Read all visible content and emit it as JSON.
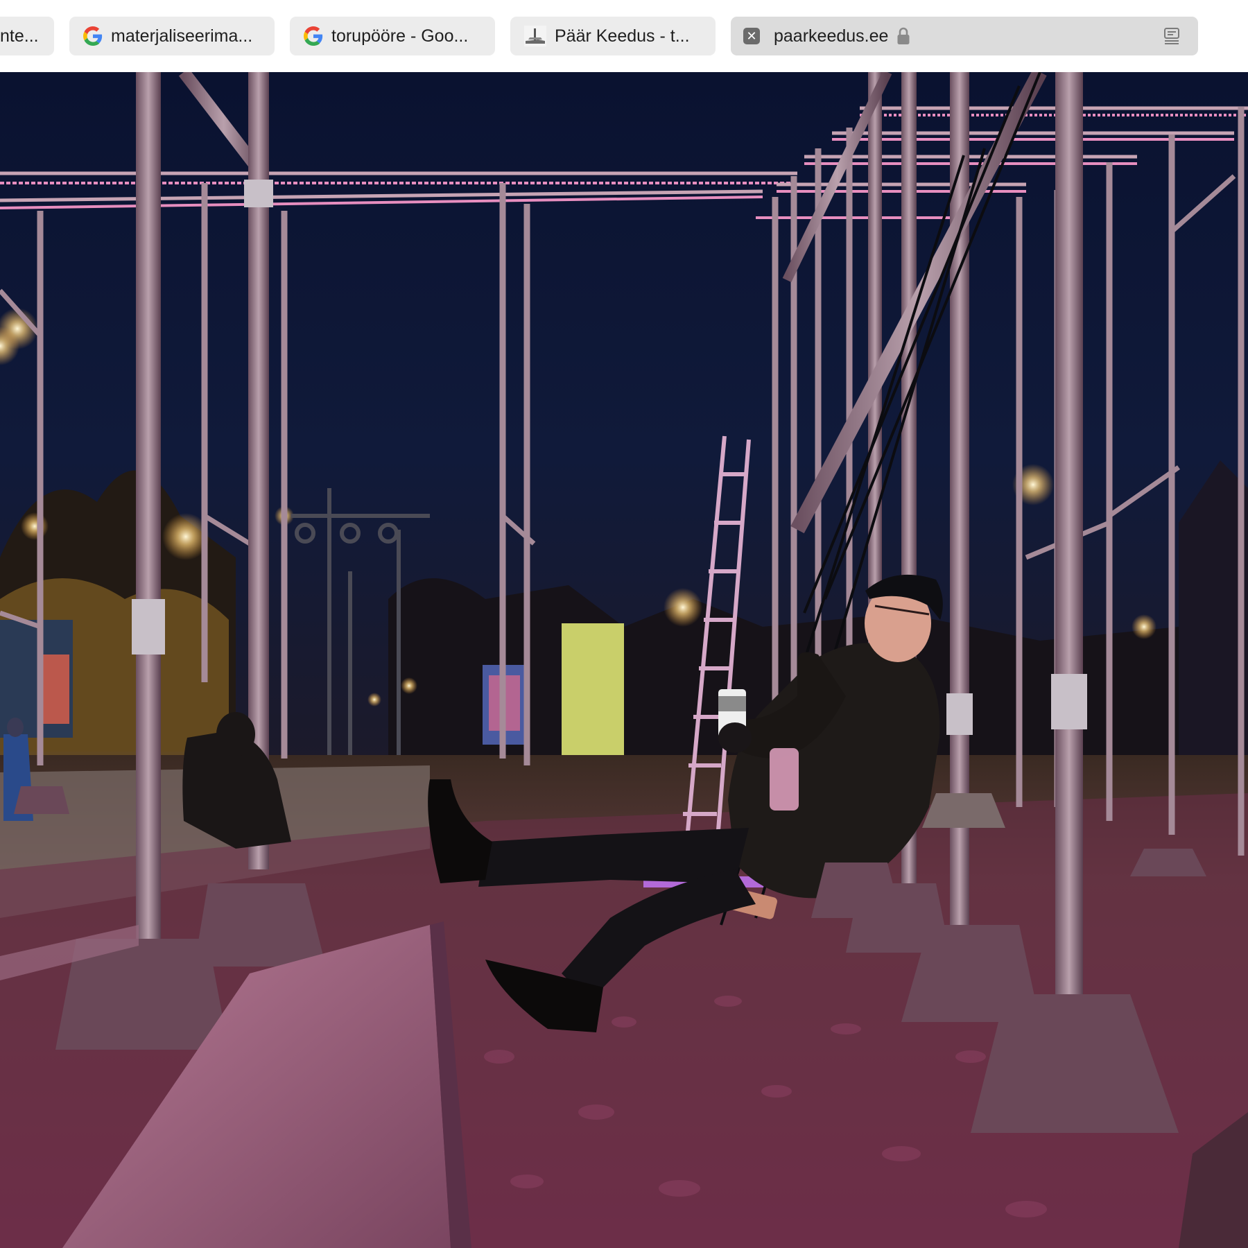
{
  "browser": {
    "tabs": [
      {
        "title": "nte...",
        "favicon": "none"
      },
      {
        "title": "materjaliseerima...",
        "favicon": "google-g-icon"
      },
      {
        "title": "torupööre - Goo...",
        "favicon": "google-g-icon"
      },
      {
        "title": "Päär Keedus - t...",
        "favicon": "site-favicon"
      },
      {
        "title": "paarkeedus.ee",
        "favicon": "close-icon",
        "active": true,
        "secure": true
      }
    ]
  },
  "page": {
    "photo_subject": "Person on a swing under an illuminated pipe-frame installation at night"
  },
  "colors": {
    "tab_bg": "#ececec",
    "active_tab_bg": "#dcdcdc",
    "sky": "#0b1430",
    "led_pink": "#ff8fc8",
    "ground_pink": "#7a3a55"
  }
}
